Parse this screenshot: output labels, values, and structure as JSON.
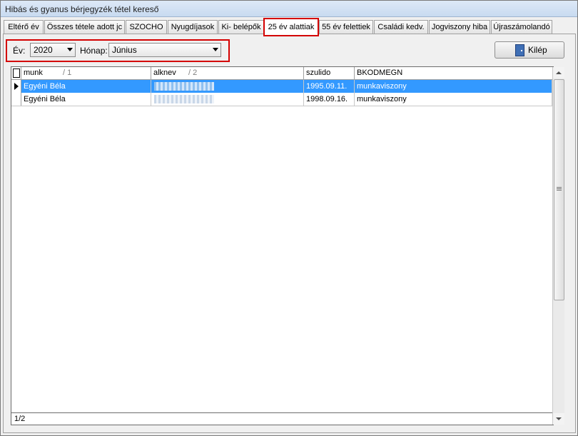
{
  "window": {
    "title": "Hibás és gyanus bérjegyzék tétel kereső"
  },
  "tabs": [
    {
      "label": "Eltérő év"
    },
    {
      "label": "Összes tétele adott jc"
    },
    {
      "label": "SZOCHO"
    },
    {
      "label": "Nyugdíjasok"
    },
    {
      "label": "Ki- belépők"
    },
    {
      "label": "25 év alattiak",
      "active": true
    },
    {
      "label": "55 év felettiek"
    },
    {
      "label": "Családi kedv."
    },
    {
      "label": "Jogviszony hiba"
    },
    {
      "label": "Újraszámolandó"
    }
  ],
  "filters": {
    "year_label": "Év:",
    "year_value": "2020",
    "month_label": "Hónap:",
    "month_value": "Június"
  },
  "exit_button": {
    "label": "Kilép",
    "icon": "door-exit-icon"
  },
  "grid": {
    "columns": [
      {
        "label": "munk",
        "sort": "1"
      },
      {
        "label": "alknev",
        "sort": "2"
      },
      {
        "label": "szulido",
        "sort": ""
      },
      {
        "label": "BKODMEGN",
        "sort": ""
      }
    ],
    "rows": [
      {
        "munk": "Egyéni Béla",
        "alknev": "",
        "szulido": "1995.09.11.",
        "bkodmegn": "munkaviszony",
        "selected": true
      },
      {
        "munk": "Egyéni Béla",
        "alknev": "",
        "szulido": "1998.09.16.",
        "bkodmegn": "munkaviszony",
        "selected": false
      }
    ],
    "footer": "1/2"
  },
  "colors": {
    "selection": "#3399ff",
    "highlight_border": "#d40000"
  }
}
